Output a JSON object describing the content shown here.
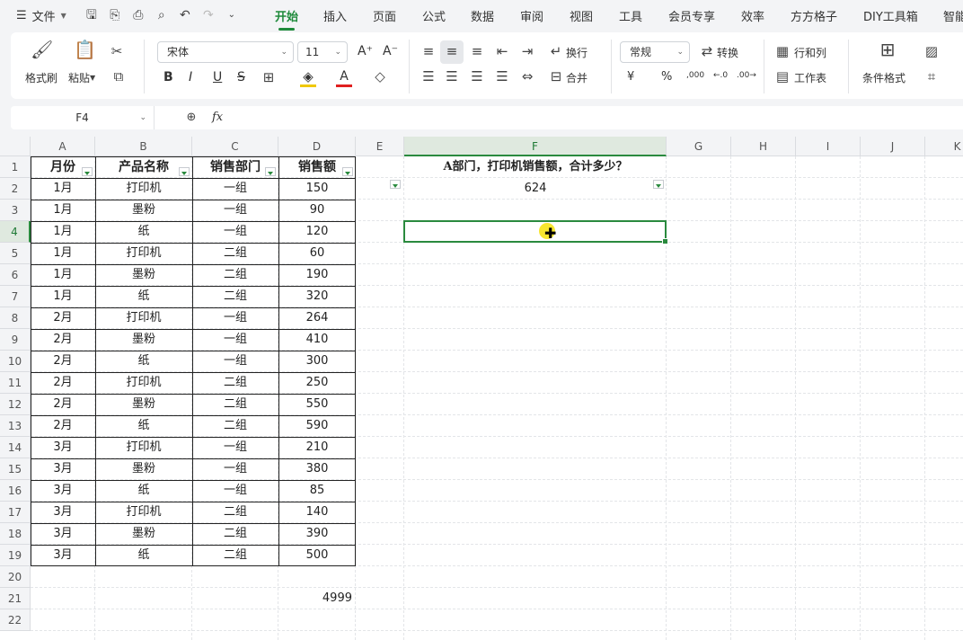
{
  "menu": {
    "menu_icon": "hamburger-icon",
    "file_label": "文件",
    "tabs": [
      {
        "label": "开始",
        "active": true
      },
      {
        "label": "插入"
      },
      {
        "label": "页面"
      },
      {
        "label": "公式"
      },
      {
        "label": "数据"
      },
      {
        "label": "审阅"
      },
      {
        "label": "视图"
      },
      {
        "label": "工具"
      },
      {
        "label": "会员专享"
      },
      {
        "label": "效率"
      },
      {
        "label": "方方格子"
      },
      {
        "label": "DIY工具箱"
      },
      {
        "label": "智能"
      }
    ]
  },
  "ribbon": {
    "format_painter": "格式刷",
    "paste": "粘贴",
    "font_name": "宋体",
    "font_size": "11",
    "bold": "B",
    "italic": "I",
    "underline": "U",
    "strike": "S",
    "font_grow": "A⁺",
    "font_shrink": "A⁻",
    "wrap_text": "换行",
    "merge": "合并",
    "number_format": "常规",
    "convert": "转换",
    "row_col": "行和列",
    "worksheet": "工作表",
    "cond_format": "条件格式",
    "currency": "¥",
    "percent": "%",
    "thousands": ",000",
    "inc_decimal": "←.0",
    "dec_decimal": ".00→",
    "accent_color": "#1f8a3b"
  },
  "formula_bar": {
    "cell_ref": "F4",
    "fx": "fx",
    "content": ""
  },
  "columns": [
    "A",
    "B",
    "C",
    "D",
    "E",
    "F",
    "G",
    "H",
    "I",
    "J",
    "K"
  ],
  "rows": [
    "1",
    "2",
    "3",
    "4",
    "5",
    "6",
    "7",
    "8",
    "9",
    "10",
    "11",
    "12",
    "13",
    "14",
    "15",
    "16",
    "17",
    "18",
    "19",
    "20",
    "21",
    "22"
  ],
  "table": {
    "headers": [
      "月份",
      "产品名称",
      "销售部门",
      "销售额"
    ],
    "data": [
      [
        "1月",
        "打印机",
        "一组",
        "150"
      ],
      [
        "1月",
        "墨粉",
        "一组",
        "90"
      ],
      [
        "1月",
        "纸",
        "一组",
        "120"
      ],
      [
        "1月",
        "打印机",
        "二组",
        "60"
      ],
      [
        "1月",
        "墨粉",
        "二组",
        "190"
      ],
      [
        "1月",
        "纸",
        "二组",
        "320"
      ],
      [
        "2月",
        "打印机",
        "一组",
        "264"
      ],
      [
        "2月",
        "墨粉",
        "一组",
        "410"
      ],
      [
        "2月",
        "纸",
        "一组",
        "300"
      ],
      [
        "2月",
        "打印机",
        "二组",
        "250"
      ],
      [
        "2月",
        "墨粉",
        "二组",
        "550"
      ],
      [
        "2月",
        "纸",
        "二组",
        "590"
      ],
      [
        "3月",
        "打印机",
        "一组",
        "210"
      ],
      [
        "3月",
        "墨粉",
        "一组",
        "380"
      ],
      [
        "3月",
        "纸",
        "一组",
        "85"
      ],
      [
        "3月",
        "打印机",
        "二组",
        "140"
      ],
      [
        "3月",
        "墨粉",
        "二组",
        "390"
      ],
      [
        "3月",
        "纸",
        "二组",
        "500"
      ]
    ],
    "total": "4999"
  },
  "question": {
    "text": "A部门，打印机销售额，合计多少？",
    "answer": "624"
  }
}
